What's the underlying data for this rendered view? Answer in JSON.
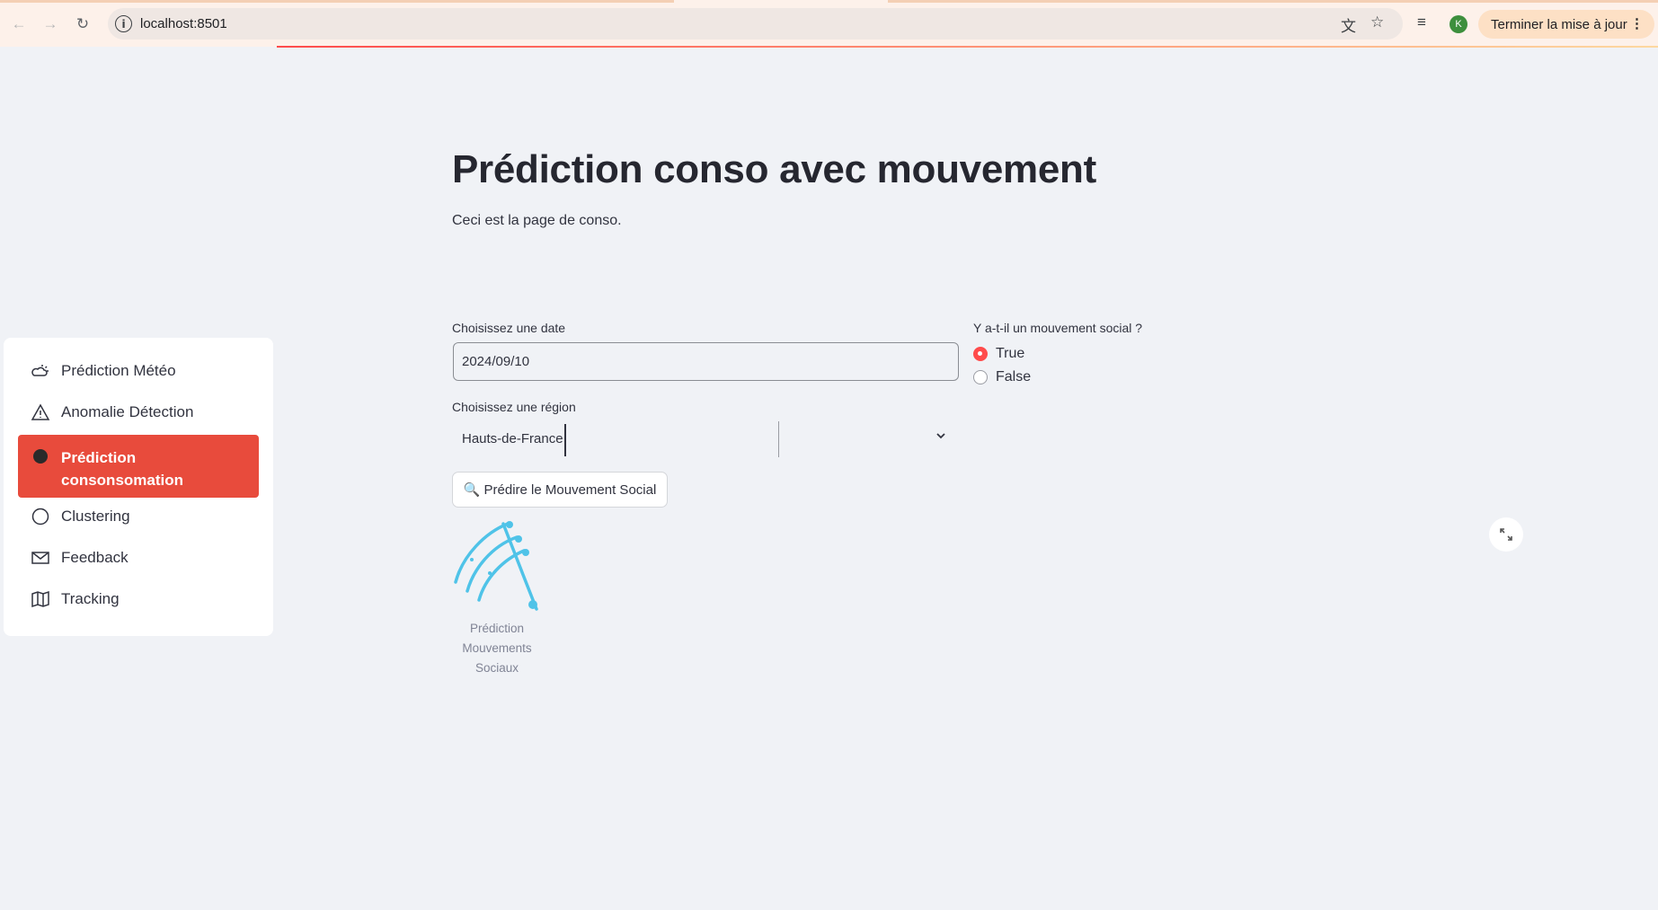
{
  "browser": {
    "url": "localhost:8501",
    "update_label": "Terminer la mise à jour",
    "profile_initial": "K"
  },
  "sidebar": {
    "items": [
      {
        "label": "Prédiction Météo",
        "icon": "weather-icon"
      },
      {
        "label": "Anomalie Détection",
        "icon": "warning-icon"
      },
      {
        "label": "Prédiction consonsomation",
        "icon": "dot-icon",
        "active": true
      },
      {
        "label": "Clustering",
        "icon": "circle-icon"
      },
      {
        "label": "Feedback",
        "icon": "envelope-icon"
      },
      {
        "label": "Tracking",
        "icon": "map-icon"
      }
    ]
  },
  "main": {
    "title": "Prédiction conso avec mouvement",
    "subtitle": "Ceci est la page de conso.",
    "date_label": "Choisissez une date",
    "date_value": "2024/09/10",
    "movement_label": "Y a-t-il un mouvement social ?",
    "radio_options": [
      "True",
      "False"
    ],
    "radio_selected": "True",
    "region_label": "Choisissez une région",
    "region_value": "Hauts-de-France",
    "predict_button": "🔍 Prédire le Mouvement Social",
    "image_caption": "Prédiction Mouvements Sociaux"
  },
  "colors": {
    "accent": "#ff4b4b",
    "sidebar_active": "#e84b3c",
    "background": "#f0f2f6"
  }
}
